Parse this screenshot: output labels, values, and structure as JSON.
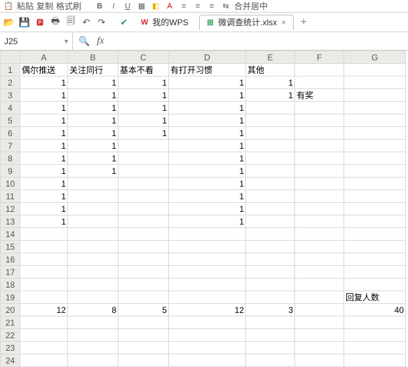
{
  "toolbar": {
    "paste_lbl": "粘贴",
    "copy_lbl": "复制",
    "fmt_lbl": "格式刷",
    "merge_lbl": "合并居中"
  },
  "quick_access": {
    "save": "💾",
    "pdf": "PDF",
    "print": "🖨",
    "preview": "👁",
    "undo": "↶",
    "redo": "↷",
    "accept": "✓"
  },
  "tabs": [
    {
      "icon": "W",
      "label": "我的WPS"
    },
    {
      "icon": "S",
      "label": "微调查统计.xlsx"
    }
  ],
  "namebox": "J25",
  "columns": [
    "A",
    "B",
    "C",
    "D",
    "E",
    "F",
    "G"
  ],
  "row_count": 24,
  "column_widths": {
    "A": 68,
    "B": 72,
    "C": 72,
    "D": 110,
    "E": 70,
    "F": 70,
    "G": 88
  },
  "cells": {
    "A1": {
      "v": "偶尔推送",
      "t": "txt"
    },
    "B1": {
      "v": "关注同行",
      "t": "txt"
    },
    "C1": {
      "v": "基本不看",
      "t": "txt"
    },
    "D1": {
      "v": "有打开习惯",
      "t": "txt"
    },
    "E1": {
      "v": "其他",
      "t": "txt"
    },
    "A2": {
      "v": "1",
      "t": "num"
    },
    "B2": {
      "v": "1",
      "t": "num"
    },
    "C2": {
      "v": "1",
      "t": "num"
    },
    "D2": {
      "v": "1",
      "t": "num"
    },
    "E2": {
      "v": "1",
      "t": "num"
    },
    "A3": {
      "v": "1",
      "t": "num"
    },
    "B3": {
      "v": "1",
      "t": "num"
    },
    "C3": {
      "v": "1",
      "t": "num"
    },
    "D3": {
      "v": "1",
      "t": "num"
    },
    "E3": {
      "v": "1",
      "t": "num"
    },
    "F3": {
      "v": "有奖",
      "t": "txt"
    },
    "A4": {
      "v": "1",
      "t": "num"
    },
    "B4": {
      "v": "1",
      "t": "num"
    },
    "C4": {
      "v": "1",
      "t": "num"
    },
    "D4": {
      "v": "1",
      "t": "num"
    },
    "A5": {
      "v": "1",
      "t": "num"
    },
    "B5": {
      "v": "1",
      "t": "num"
    },
    "C5": {
      "v": "1",
      "t": "num"
    },
    "D5": {
      "v": "1",
      "t": "num"
    },
    "A6": {
      "v": "1",
      "t": "num"
    },
    "B6": {
      "v": "1",
      "t": "num"
    },
    "C6": {
      "v": "1",
      "t": "num"
    },
    "D6": {
      "v": "1",
      "t": "num"
    },
    "A7": {
      "v": "1",
      "t": "num"
    },
    "B7": {
      "v": "1",
      "t": "num"
    },
    "D7": {
      "v": "1",
      "t": "num"
    },
    "A8": {
      "v": "1",
      "t": "num"
    },
    "B8": {
      "v": "1",
      "t": "num"
    },
    "D8": {
      "v": "1",
      "t": "num"
    },
    "A9": {
      "v": "1",
      "t": "num"
    },
    "B9": {
      "v": "1",
      "t": "num"
    },
    "D9": {
      "v": "1",
      "t": "num"
    },
    "A10": {
      "v": "1",
      "t": "num"
    },
    "D10": {
      "v": "1",
      "t": "num"
    },
    "A11": {
      "v": "1",
      "t": "num"
    },
    "D11": {
      "v": "1",
      "t": "num"
    },
    "A12": {
      "v": "1",
      "t": "num"
    },
    "D12": {
      "v": "1",
      "t": "num"
    },
    "A13": {
      "v": "1",
      "t": "num"
    },
    "D13": {
      "v": "1",
      "t": "num"
    },
    "G19": {
      "v": "回复人数",
      "t": "txt"
    },
    "A20": {
      "v": "12",
      "t": "num"
    },
    "B20": {
      "v": "8",
      "t": "num"
    },
    "C20": {
      "v": "5",
      "t": "num"
    },
    "D20": {
      "v": "12",
      "t": "num"
    },
    "E20": {
      "v": "3",
      "t": "num"
    },
    "G20": {
      "v": "40",
      "t": "num"
    }
  }
}
